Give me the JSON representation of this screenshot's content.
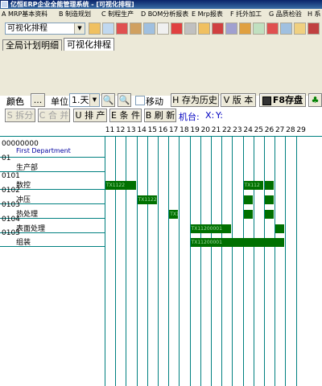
{
  "window": {
    "title": "亿恒ERP企业全能管理系统 - [可视化排程]"
  },
  "menu": [
    {
      "label": "A MRP基本资料"
    },
    {
      "label": "B 制造规划"
    },
    {
      "label": "C 制程生产"
    },
    {
      "label": "D BOM分析报表"
    },
    {
      "label": "E Mrp报表"
    },
    {
      "label": "F 托外加工"
    },
    {
      "label": "G 品质检验"
    },
    {
      "label": "H 系"
    }
  ],
  "toolbar": {
    "module_select": "可视化排程"
  },
  "tabs": [
    {
      "label": "全局计划明细",
      "active": false
    },
    {
      "label": "可视化排程",
      "active": true
    }
  ],
  "controls": {
    "color_label": "颜色",
    "color_button": "...",
    "unit_label": "单位",
    "unit_value": "1.天",
    "move_label": "移动",
    "save_history": "H 存为历史",
    "version": "V 版 本",
    "f8_save": "F8存盘",
    "split": "S 拆分",
    "merge": "C 合 并",
    "schedule": "U 排 产",
    "condition": "E 条 件",
    "refresh": "B 刷 新",
    "machine": "机台:",
    "x_label": "X:",
    "y_label": "Y:"
  },
  "gantt": {
    "days": [
      "11",
      "12",
      "13",
      "14",
      "15",
      "16",
      "17",
      "18",
      "19",
      "20",
      "21",
      "22",
      "23",
      "24",
      "25",
      "26",
      "27",
      "28",
      "29"
    ],
    "rows": [
      {
        "code": "00000000",
        "name": "First Department",
        "blue": true
      },
      {
        "code": "01",
        "name": "生产部"
      },
      {
        "code": "0101",
        "name": "数控"
      },
      {
        "code": "0102",
        "name": "冲压"
      },
      {
        "code": "0103",
        "name": "热处理"
      },
      {
        "code": "0104",
        "name": "表面处理"
      },
      {
        "code": "0105",
        "name": "组装"
      }
    ],
    "bars": [
      {
        "row": 2,
        "start_day": "11",
        "end_day": "13",
        "label": "TX1122"
      },
      {
        "row": 2,
        "start_day": "24",
        "end_day": "25",
        "label": "TX112"
      },
      {
        "row": 2,
        "start_day": "26",
        "end_day": "26",
        "label": ""
      },
      {
        "row": 3,
        "start_day": "14",
        "end_day": "15",
        "label": "TX1122"
      },
      {
        "row": 3,
        "start_day": "24",
        "end_day": "24",
        "label": ""
      },
      {
        "row": 3,
        "start_day": "26",
        "end_day": "26",
        "label": ""
      },
      {
        "row": 4,
        "start_day": "17",
        "end_day": "17",
        "label": "TX1"
      },
      {
        "row": 4,
        "start_day": "24",
        "end_day": "24",
        "label": ""
      },
      {
        "row": 4,
        "start_day": "26",
        "end_day": "26",
        "label": ""
      },
      {
        "row": 5,
        "start_day": "19",
        "end_day": "22",
        "label": "TX11200001"
      },
      {
        "row": 5,
        "start_day": "27",
        "end_day": "27",
        "label": ""
      },
      {
        "row": 6,
        "start_day": "19",
        "end_day": "27",
        "label": "TX11200001"
      }
    ],
    "bar_color": "#007000",
    "grid_color": "#008080"
  }
}
